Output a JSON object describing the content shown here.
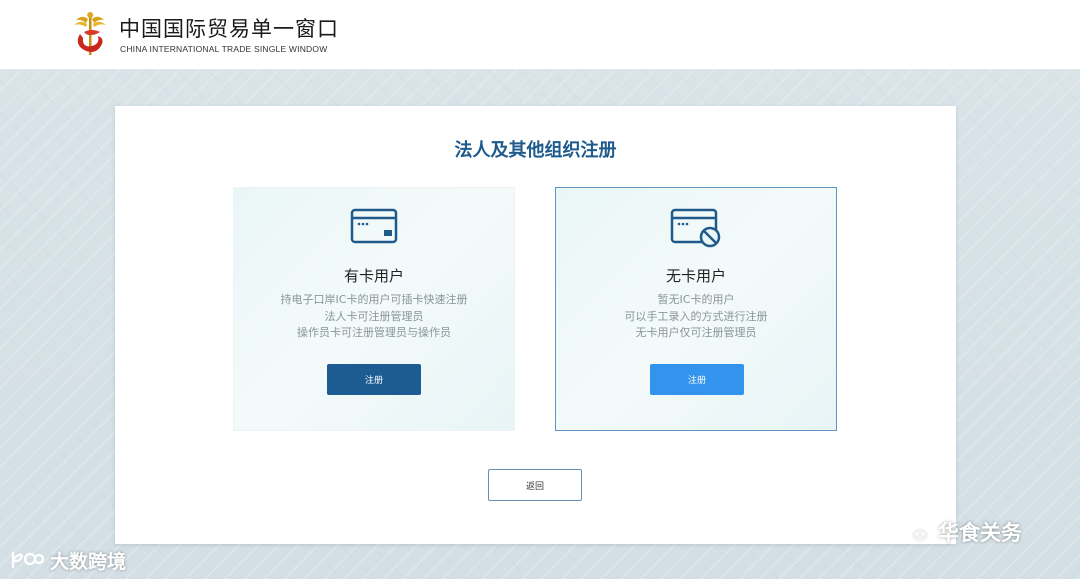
{
  "header": {
    "title": "中国国际贸易单一窗口",
    "subtitle": "CHINA INTERNATIONAL TRADE SINGLE WINDOW"
  },
  "panel": {
    "title": "法人及其他组织注册"
  },
  "cards": {
    "with_card": {
      "title": "有卡用户",
      "desc_line1": "持电子口岸IC卡的用户可插卡快速注册",
      "desc_line2": "法人卡可注册管理员",
      "desc_line3": "操作员卡可注册管理员与操作员",
      "button_label": "注册",
      "icon": "card-icon"
    },
    "without_card": {
      "title": "无卡用户",
      "desc_line1": "暂无IC卡的用户",
      "desc_line2": "可以手工录入的方式进行注册",
      "desc_line3": "无卡用户仅可注册管理员",
      "button_label": "注册",
      "icon": "no-card-icon"
    }
  },
  "back_label": "返回",
  "watermarks": {
    "left": "大数跨境",
    "right": "华食关务"
  },
  "colors": {
    "title_blue": "#1e5a8c",
    "button_dark": "#1d5c92",
    "button_light": "#3394ee",
    "selected_border": "#5f95c0"
  }
}
